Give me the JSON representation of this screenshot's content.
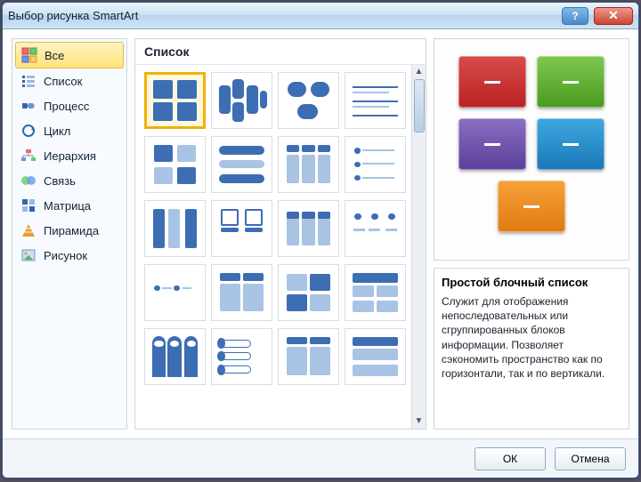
{
  "window": {
    "title": "Выбор рисунка SmartArt"
  },
  "sidebar": {
    "items": [
      {
        "label": "Все",
        "selected": true
      },
      {
        "label": "Список"
      },
      {
        "label": "Процесс"
      },
      {
        "label": "Цикл"
      },
      {
        "label": "Иерархия"
      },
      {
        "label": "Связь"
      },
      {
        "label": "Матрица"
      },
      {
        "label": "Пирамида"
      },
      {
        "label": "Рисунок"
      }
    ]
  },
  "gallery": {
    "heading": "Список"
  },
  "preview": {
    "title": "Простой блочный список",
    "description": "Служит для отображения непоследовательных или сгруппированных блоков информации. Позволяет сэкономить пространство как по горизонтали, так и по вертикали."
  },
  "footer": {
    "ok": "ОК",
    "cancel": "Отмена"
  }
}
